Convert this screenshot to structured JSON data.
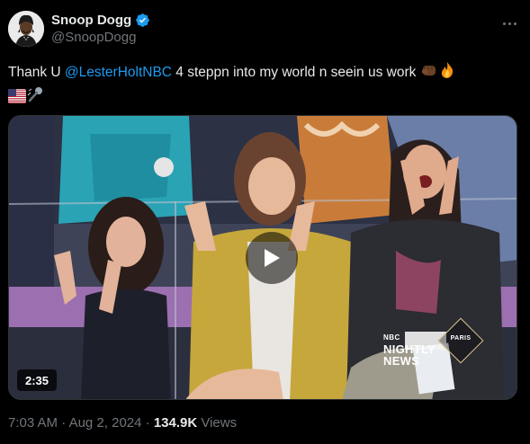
{
  "author": {
    "display_name": "Snoop Dogg",
    "handle": "@SnoopDogg",
    "verified": true
  },
  "tweet": {
    "text_before": "Thank U ",
    "mention": "@LesterHoltNBC",
    "text_after": " 4 steppn into my world n seein us work ",
    "emojis": [
      "fist-medium-dark-skin",
      "fire",
      "us-flag",
      "microphone"
    ]
  },
  "media": {
    "type": "video",
    "duration": "2:35",
    "overlay_small": "NBC",
    "overlay_line1": "NIGHTLY",
    "overlay_line2": "NEWS",
    "badge_text": "PARIS"
  },
  "meta": {
    "time": "7:03 AM",
    "separator": " · ",
    "date": "Aug 2, 2024",
    "views_count": "134.9K",
    "views_label": " Views"
  },
  "colors": {
    "background": "#000000",
    "text": "#e7e9ea",
    "secondary": "#71767b",
    "link": "#1d9bf0",
    "verified": "#1d9bf0"
  }
}
